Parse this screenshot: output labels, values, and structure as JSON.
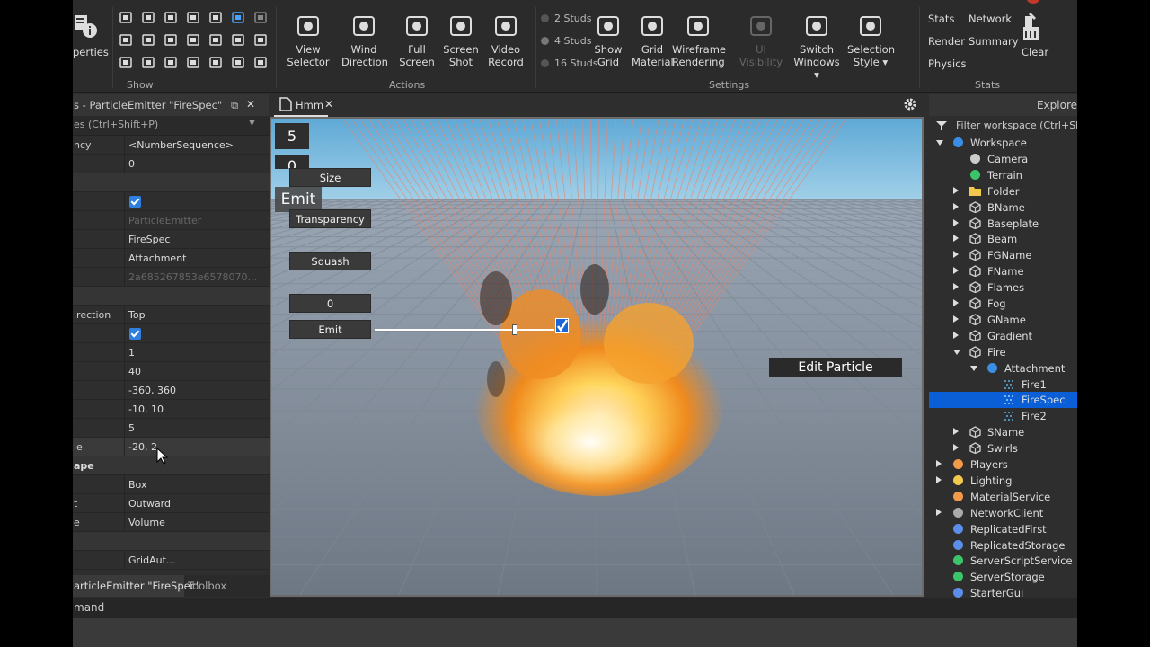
{
  "ribbon": {
    "properties_label": "perties",
    "show_label": "Show",
    "actions_label": "Actions",
    "settings_label": "Settings",
    "stats_group_label": "Stats",
    "buttons": [
      {
        "label": "View\nSelector",
        "icon": "view-selector-icon"
      },
      {
        "label": "Wind\nDirection",
        "icon": "wind-direction-icon"
      },
      {
        "label": "Full\nScreen",
        "icon": "full-screen-icon"
      },
      {
        "label": "Screen\nShot",
        "icon": "camera-icon"
      },
      {
        "label": "Video\nRecord",
        "icon": "video-record-icon"
      },
      {
        "label": "Show\nGrid",
        "icon": "grid-icon"
      },
      {
        "label": "Grid\nMaterial",
        "icon": "checker-icon"
      },
      {
        "label": "Wireframe\nRendering",
        "icon": "wireframe-icon"
      },
      {
        "label": "UI Visibility",
        "icon": "eye-icon"
      },
      {
        "label": "Switch\nWindows ▾",
        "icon": "switch-windows-icon"
      },
      {
        "label": "Selection\nStyle ▾",
        "icon": "selection-style-icon"
      }
    ],
    "studs": [
      "2 Studs",
      "4 Studs",
      "16 Studs"
    ],
    "stats": [
      "Stats",
      "Network",
      "Render",
      "Summary",
      "Physics"
    ],
    "clear_label": "Clear"
  },
  "properties": {
    "title": "s - ParticleEmitter \"FireSpec\"",
    "filter": "es (Ctrl+Shift+P)",
    "rows": [
      {
        "k": "ncy",
        "v": "<NumberSequence>"
      },
      {
        "k": "",
        "v": "0"
      },
      {
        "k": "",
        "v": "",
        "cat": true
      },
      {
        "k": "",
        "v": "",
        "check": true
      },
      {
        "k": "",
        "v": "ParticleEmitter",
        "dim": true
      },
      {
        "k": "",
        "v": "FireSpec"
      },
      {
        "k": "",
        "v": "Attachment"
      },
      {
        "k": "",
        "v": "2a685267853e6578070...",
        "dim": true
      },
      {
        "k": "",
        "v": "",
        "cat": true
      },
      {
        "k": "irection",
        "v": "Top"
      },
      {
        "k": "",
        "v": "",
        "check": true
      },
      {
        "k": "",
        "v": "1"
      },
      {
        "k": "",
        "v": "40"
      },
      {
        "k": "",
        "v": "-360, 360"
      },
      {
        "k": "",
        "v": "-10, 10"
      },
      {
        "k": "",
        "v": "5"
      },
      {
        "k": "le",
        "v": "-20, 2",
        "hover": true
      },
      {
        "k": "ape",
        "v": "",
        "cat": true
      },
      {
        "k": "",
        "v": "Box"
      },
      {
        "k": "t",
        "v": "Outward"
      },
      {
        "k": "e",
        "v": "Volume"
      },
      {
        "k": "",
        "v": "",
        "cat": true
      },
      {
        "k": "",
        "v": "GridAut..."
      }
    ],
    "bottom_tab_active": "articleEmitter \"FireSpec\"",
    "bottom_tab_toolbox": "Toolbox"
  },
  "command_bar": "mand",
  "viewport": {
    "tab": "Hmm",
    "counter_top": "5",
    "counter_bottom": "0",
    "emit_large": "Emit",
    "buttons": [
      "Size",
      "Transparency",
      "Squash",
      "0",
      "Emit"
    ],
    "edit_particle": "Edit Particle",
    "slider_value": 0.78
  },
  "explorer": {
    "title": "Explore",
    "filter": "Filter workspace (Ctrl+Shift",
    "tree": [
      {
        "label": "Workspace",
        "indent": 0,
        "arrow": "d",
        "icon": "globe-icon",
        "color": "#3a8ee6"
      },
      {
        "label": "Camera",
        "indent": 1,
        "arrow": "",
        "icon": "camera-icon",
        "color": "#ccc"
      },
      {
        "label": "Terrain",
        "indent": 1,
        "arrow": "",
        "icon": "terrain-icon",
        "color": "#3cc46a"
      },
      {
        "label": "Folder",
        "indent": 1,
        "arrow": "r",
        "icon": "folder-icon",
        "color": "#f2c94c"
      },
      {
        "label": "BName",
        "indent": 1,
        "arrow": "r",
        "icon": "model-icon",
        "color": "#ccc"
      },
      {
        "label": "Baseplate",
        "indent": 1,
        "arrow": "r",
        "icon": "model-icon",
        "color": "#ccc"
      },
      {
        "label": "Beam",
        "indent": 1,
        "arrow": "r",
        "icon": "model-icon",
        "color": "#ccc"
      },
      {
        "label": "FGName",
        "indent": 1,
        "arrow": "r",
        "icon": "model-icon",
        "color": "#ccc"
      },
      {
        "label": "FName",
        "indent": 1,
        "arrow": "r",
        "icon": "model-icon",
        "color": "#ccc"
      },
      {
        "label": "Flames",
        "indent": 1,
        "arrow": "r",
        "icon": "model-icon",
        "color": "#ccc"
      },
      {
        "label": "Fog",
        "indent": 1,
        "arrow": "r",
        "icon": "model-icon",
        "color": "#ccc"
      },
      {
        "label": "GName",
        "indent": 1,
        "arrow": "r",
        "icon": "model-icon",
        "color": "#ccc"
      },
      {
        "label": "Gradient",
        "indent": 1,
        "arrow": "r",
        "icon": "model-icon",
        "color": "#ccc"
      },
      {
        "label": "Fire",
        "indent": 1,
        "arrow": "d",
        "icon": "model-icon",
        "color": "#ccc"
      },
      {
        "label": "Attachment",
        "indent": 2,
        "arrow": "d",
        "icon": "attachment-icon",
        "color": "#3a8ee6"
      },
      {
        "label": "Fire1",
        "indent": 3,
        "arrow": "",
        "icon": "particle-icon",
        "color": "#5ab0e8"
      },
      {
        "label": "FireSpec",
        "indent": 3,
        "arrow": "",
        "icon": "particle-icon",
        "color": "#9fd3ff",
        "sel": true
      },
      {
        "label": "Fire2",
        "indent": 3,
        "arrow": "",
        "icon": "particle-icon",
        "color": "#5ab0e8"
      },
      {
        "label": "SName",
        "indent": 1,
        "arrow": "r",
        "icon": "model-icon",
        "color": "#ccc"
      },
      {
        "label": "Swirls",
        "indent": 1,
        "arrow": "r",
        "icon": "model-icon",
        "color": "#ccc"
      },
      {
        "label": "Players",
        "indent": 0,
        "arrow": "r",
        "icon": "players-icon",
        "color": "#f2994a"
      },
      {
        "label": "Lighting",
        "indent": 0,
        "arrow": "r",
        "icon": "bulb-icon",
        "color": "#f2c94c"
      },
      {
        "label": "MaterialService",
        "indent": 0,
        "arrow": "",
        "icon": "material-icon",
        "color": "#f2994a"
      },
      {
        "label": "NetworkClient",
        "indent": 0,
        "arrow": "r",
        "icon": "network-icon",
        "color": "#aaa"
      },
      {
        "label": "ReplicatedFirst",
        "indent": 0,
        "arrow": "",
        "icon": "replicated-icon",
        "color": "#5a8ee8"
      },
      {
        "label": "ReplicatedStorage",
        "indent": 0,
        "arrow": "",
        "icon": "storage-icon",
        "color": "#5a8ee8"
      },
      {
        "label": "ServerScriptService",
        "indent": 0,
        "arrow": "",
        "icon": "script-service-icon",
        "color": "#3cc46a"
      },
      {
        "label": "ServerStorage",
        "indent": 0,
        "arrow": "",
        "icon": "server-storage-icon",
        "color": "#3cc46a"
      },
      {
        "label": "StarterGui",
        "indent": 0,
        "arrow": "",
        "icon": "gui-icon",
        "color": "#5a8ee8"
      }
    ]
  }
}
